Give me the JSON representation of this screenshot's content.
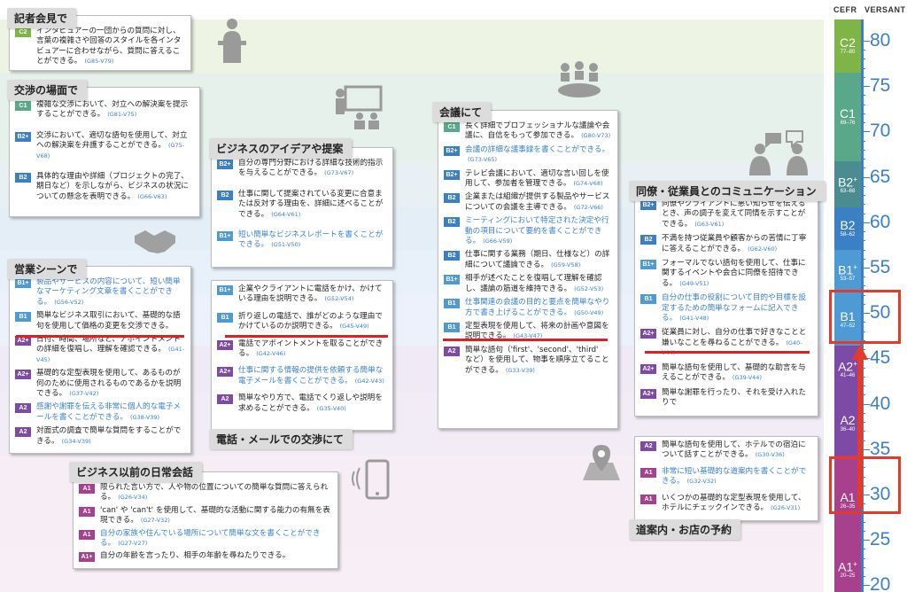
{
  "scale": {
    "cefr_label": "CEFR",
    "versant_label": "VERSANT",
    "levels": [
      {
        "code": "C2",
        "sup": "",
        "range": "77–80",
        "color": "#7fb547"
      },
      {
        "code": "C1",
        "sup": "",
        "range": "69–76",
        "color": "#5aa88a"
      },
      {
        "code": "B2",
        "sup": "+",
        "range": "63–68",
        "color": "#4a8c8f"
      },
      {
        "code": "B2",
        "sup": "",
        "range": "58–62",
        "color": "#3b80c4"
      },
      {
        "code": "B1",
        "sup": "+",
        "range": "53–57",
        "color": "#4e9ad4"
      },
      {
        "code": "B1",
        "sup": "",
        "range": "47–52",
        "color": "#4e9ad4"
      },
      {
        "code": "A2",
        "sup": "+",
        "range": "41–46",
        "color": "#7d4aa6"
      },
      {
        "code": "A2",
        "sup": "",
        "range": "36–40",
        "color": "#7d4aa6"
      },
      {
        "code": "A1",
        "sup": "",
        "range": "26–35",
        "color": "#a7408d"
      },
      {
        "code": "A1",
        "sup": "+",
        "range": "20–25",
        "color": "#a7408d"
      }
    ],
    "numbers": [
      "80",
      "75",
      "70",
      "65",
      "60",
      "55",
      "50",
      "45",
      "40",
      "35",
      "30",
      "25",
      "20"
    ]
  },
  "sections": {
    "press": {
      "title": "記者会見で",
      "items": [
        {
          "level": "C2",
          "text": "インタビュアーの一団からの質問に対し、言葉の複雑さや回答のスタイルを各インタビュアーに合わせながら、質問に答えることができる。",
          "code": "(G85-V79)"
        }
      ]
    },
    "negotiation": {
      "title": "交渉の場面で",
      "items": [
        {
          "level": "C1",
          "text": "複雑な交渉において、対立への解決案を提示することができる。",
          "code": "(G81-V75)"
        },
        {
          "level": "B2+",
          "text": "交渉において、適切な語句を使用して、対立への解決案を弁護することができる。",
          "code": "(G75-V68)"
        },
        {
          "level": "B2",
          "text": "具体的な理由や詳細（プロジェクトの完了、期日など）を示しながら、ビジネスの状況についての懸念を表明できる。",
          "code": "(G66-V63)"
        }
      ]
    },
    "ideas": {
      "title": "ビジネスのアイデアや提案",
      "items": [
        {
          "level": "B2+",
          "text": "自分の専門分野における詳細な技術的指示を与えることができる。",
          "code": "(G73-V67)"
        },
        {
          "level": "B2",
          "text": "仕事に関して提案されている変更に合意または反対する理由を、詳細に述べることができる。",
          "code": "(G64-V61)"
        },
        {
          "level": "B1+",
          "text": "短い簡単なビジネスレポートを書くことができる。",
          "code": "(G51-V50)"
        }
      ]
    },
    "sales": {
      "title": "営業シーンで",
      "items": [
        {
          "level": "B1+",
          "text": "製品やサービスの内容について、短い簡単なマーケティング文章を書くことができる。",
          "code": "(G56-V52)"
        },
        {
          "level": "B1",
          "text": "簡単なビジネス取引において、基礎的な語句を使用して価格の変更を交渉できる。",
          "code": ""
        },
        {
          "level": "A2+",
          "text": "日付、時間、場所など、アポイントメントの詳細を復唱し、理解を確認できる。",
          "code": "(G41-V45)"
        },
        {
          "level": "A2+",
          "text": "基礎的な定型表現を使用して、あるものが何のために使用されるものであるかを説明できる。",
          "code": "(G37-V42)"
        },
        {
          "level": "A2",
          "text": "感謝や謝罪を伝える非常に個人的な電子メールを書くことができる。",
          "code": "(G38-V39)"
        },
        {
          "level": "A2",
          "text": "対面式の調査で簡単な質問をすることができる。",
          "code": "(G34-V39)"
        }
      ]
    },
    "phone": {
      "title": "電話・メールでの交渉にて",
      "items": [
        {
          "level": "B1+",
          "text": "企業やクライアントに電話をかけ、かけている理由を説明できる。",
          "code": "(G52-V54)"
        },
        {
          "level": "B1",
          "text": "折り返しの電話で、誰がどのような理由でかけているのか説明できる。",
          "code": "(G45-V49)"
        },
        {
          "level": "A2+",
          "text": "電話でアポイントメントを取ることができる。",
          "code": "(G42-V46)"
        },
        {
          "level": "A2+",
          "text": "仕事に関する情報の提供を依頼する簡単な電子メールを書くことができる。",
          "code": "(G42-V43)"
        },
        {
          "level": "A2",
          "text": "簡単なやり方で、電話でくり返しや説明を求めることができる。",
          "code": "(G35-V40)"
        }
      ]
    },
    "meeting": {
      "title": "会議にて",
      "items": [
        {
          "level": "C1",
          "text": "長く詳細でプロフェッショナルな議論や会議に、自信をもって参加できる。",
          "code": "(G80-V73)"
        },
        {
          "level": "B2+",
          "text": "会議の詳細な議事録を書くことができる。",
          "code": "(G73-V65)"
        },
        {
          "level": "B2+",
          "text": "テレビ会議において、適切な言い回しを使用して、参加者を管理できる。",
          "code": "(G74-V68)"
        },
        {
          "level": "B2",
          "text": "企業または組織が提供する製品やサービスについての会議を主導できる。",
          "code": "(G72-V66)"
        },
        {
          "level": "B2",
          "text": "ミーティングにおいて特定された決定や行動の項目について要約を書くことができる。",
          "code": "(G66-V59)"
        },
        {
          "level": "B2",
          "text": "仕事に関する業務（期日、仕様など）の詳細について議論できる。",
          "code": "(G59-V58)"
        },
        {
          "level": "B1+",
          "text": "相手が述べたことを復唱して理解を確認し、議論の筋道を維持できる。",
          "code": "(G52-V53)"
        },
        {
          "level": "B1",
          "text": "仕事関連の会議の目的と要点を簡単なやり方で書き上げることができる。",
          "code": "(G50-V49)"
        },
        {
          "level": "B1",
          "text": "定型表現を使用して、将来の計画や意図を説明できる。",
          "code": "(G43-V47)"
        },
        {
          "level": "A2",
          "text": "簡単な語句（'first'、'second'、'third'　など）を使用して、物事を順序立てることができる。",
          "code": "(G33-V39)"
        }
      ]
    },
    "colleague": {
      "title": "同僚・従業員とのコミュニケーション",
      "items": [
        {
          "level": "B2+",
          "text": "同僚やクライアントに悪い知らせを伝えるとき、声の調子を変えて同情を示すことができる。",
          "code": "(G63-V61)"
        },
        {
          "level": "B2",
          "text": "不満を持つ従業員や顧客からの苦情に丁寧に答えることができる。",
          "code": "(G62-V60)"
        },
        {
          "level": "B1+",
          "text": "フォーマルでない語句を使用して、仕事に関するイベントや会合に同僚を招待できる。",
          "code": "(G49-V51)"
        },
        {
          "level": "B1",
          "text": "自分の仕事の役割について目的や目標を設定するための簡単なフォームに記入できる。",
          "code": "(G41-V48)"
        },
        {
          "level": "A2+",
          "text": "従業員に対し、自分の仕事で好きなことと嫌いなことを尋ねることができる。",
          "code": "(G40-V44)"
        },
        {
          "level": "A2+",
          "text": "簡単な語句を使用して、基礎的な助言を与えることができる。",
          "code": "(G39-V44)"
        },
        {
          "level": "A2+",
          "text": "簡単な謝罪を行ったり、それを受け入れたりで",
          "code": ""
        }
      ]
    },
    "travel": {
      "title": "道案内・お店の予約",
      "items": [
        {
          "level": "A2",
          "text": "簡単な語句を使用して、ホテルでの宿泊について話すことができる。",
          "code": "(G30-V36)"
        },
        {
          "level": "A1",
          "text": "非常に短い基礎的な道案内を書くことができる。",
          "code": "(G32-V32)"
        },
        {
          "level": "A1",
          "text": "いくつかの基礎的な定型表現を使用して、ホテルにチェックインできる。",
          "code": "(G26-V31)"
        }
      ]
    },
    "daily": {
      "title": "ビジネス以前の日常会話",
      "items": [
        {
          "level": "A1",
          "text": "限られた言い方で、人や物の位置についての簡単な質問に答えられる。",
          "code": "(G26-V34)"
        },
        {
          "level": "A1",
          "text": "'can' や 'can't' を使用して、基礎的な活動に関する能力の有無を表現できる。",
          "code": "(G27-V32)"
        },
        {
          "level": "A1",
          "text": "自分の家族や住んでいる場所について簡単な文を書くことができる。",
          "code": "(G27-V27)"
        },
        {
          "level": "A1+",
          "text": "自分の年齢を言ったり、相手の年齢を尋ねたりできる。",
          "code": ""
        }
      ]
    }
  },
  "colors": {
    "accent_red": "#e53a2a",
    "scale_blue": "#3b7fc4",
    "link_blue": "#3a80c8"
  }
}
